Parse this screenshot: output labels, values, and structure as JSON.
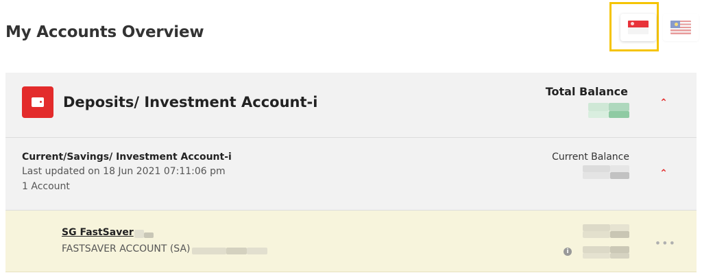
{
  "header": {
    "title": "My Accounts Overview",
    "region_selector": {
      "selected": "sg-flag-icon",
      "options": [
        "sg-flag-icon",
        "my-flag-icon"
      ],
      "highlight_color": "#f5c400"
    }
  },
  "deposits_section": {
    "title": "Deposits/ Investment Account-i",
    "icon": "wallet-icon",
    "accent_color": "#e32b2b",
    "total_balance_label": "Total Balance",
    "expanded": true
  },
  "account_group": {
    "title": "Current/Savings/ Investment Account-i",
    "last_updated": "Last updated on 18 Jun 2021 07:11:06 pm",
    "account_count": "1 Account",
    "current_balance_label": "Current Balance",
    "expanded": true
  },
  "account_row": {
    "name": "SG FastSaver",
    "type": "FASTSAVER ACCOUNT (SA)",
    "info_icon": "info-icon",
    "more_icon": "more-options-icon",
    "background_color": "#f7f4dc"
  }
}
